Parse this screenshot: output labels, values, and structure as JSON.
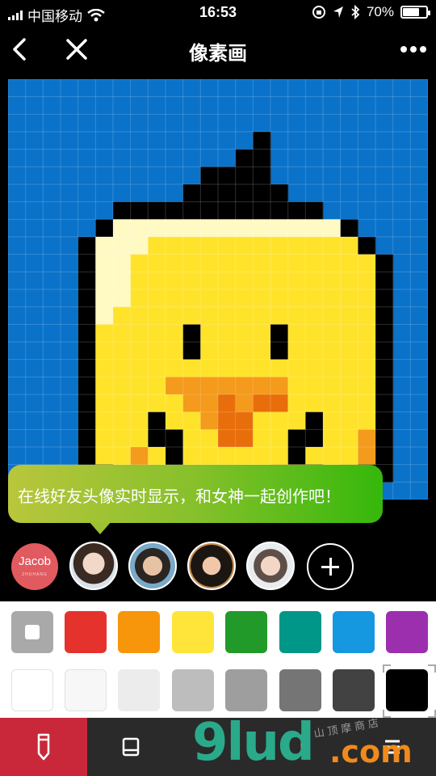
{
  "status_bar": {
    "carrier": "中国移动",
    "time": "16:53",
    "battery": "70%",
    "battery_level": 0.7,
    "icons": [
      "signal-icon",
      "wifi-icon",
      "rotation-lock-icon",
      "location-icon",
      "bluetooth-icon",
      "battery-icon"
    ]
  },
  "nav": {
    "title": "像素画",
    "icons": [
      "back-icon",
      "close-icon",
      "more-icon"
    ]
  },
  "canvas": {
    "background": "#0a72c9",
    "grid_cells": 24,
    "palette_map": {
      "K": "#000000",
      "Y": "#ffe32b",
      "L": "#fff9c4",
      "O": "#f49a1c",
      "R": "#e86e0c",
      "B": "#0a5bae"
    },
    "pixels": [
      "........................",
      "........................",
      "..........................",
      "..............K.........",
      ".............KK.........",
      "...........KKKK.........",
      "..........KKKKKK........",
      "......KKKKKKKKKKKK......",
      ".....KLLLLLLLLLLLLLK.....",
      "....KLLLYYYYYYYYYYYYK....",
      "....KLLYYYYYYYYYYYYYYK...",
      "....KLLYYYYYYYYYYYYYYK...",
      "....KLLYYYYYYYYYYYYYYK...",
      "....KLYYYYYYYYYYYYYYYK...",
      "....KYYYYYKYYYYKYYYYYK...",
      "....KYYYYYKYYYYKYYYYYK...",
      "....KYYYYYYYYYYYYYYYYK...",
      "....KYYYYOOOOOOOYYYYYK...",
      "....KYYYYYOORORRYYYYYK...",
      "....KYYYKYYORRYYYKYYYK...",
      "....KYYYKKYYRRYYKKYYOK...",
      "....KYYOYKYYYYYYKYYYOK...",
      ".....KYOYKYYYYYOOKYOKK...",
      "......KOYKYYYYOOOKOK....."
    ]
  },
  "tooltip": {
    "text": "在线好友头像实时显示，和女神一起创作吧！"
  },
  "avatars": {
    "first_name": "Jacob",
    "first_sub": "ZHUHANG",
    "items": [
      "avatar-jacob",
      "avatar-girl-1",
      "avatar-boy-1",
      "avatar-girl-2",
      "avatar-boy-2"
    ]
  },
  "palette": {
    "row1": [
      "#a9a9a9",
      "#e5322d",
      "#f7950b",
      "#ffe53a",
      "#219a2a",
      "#009688",
      "#1598e0",
      "#9b2fae"
    ],
    "row2": [
      "#ffffff",
      "#f7f7f7",
      "#ececec",
      "#bdbdbd",
      "#9e9e9e",
      "#757575",
      "#424242",
      "#000000"
    ],
    "selected": "#000000"
  },
  "toolbar": {
    "tools": [
      "pencil-icon",
      "layers-icon",
      "next-icon",
      "pen-icon",
      "menu-icon"
    ],
    "active": "pencil-icon",
    "active_color": "#c8283a"
  },
  "watermark": {
    "main": "9lud",
    "suffix": ".com",
    "cn": "山顶摩商店"
  }
}
